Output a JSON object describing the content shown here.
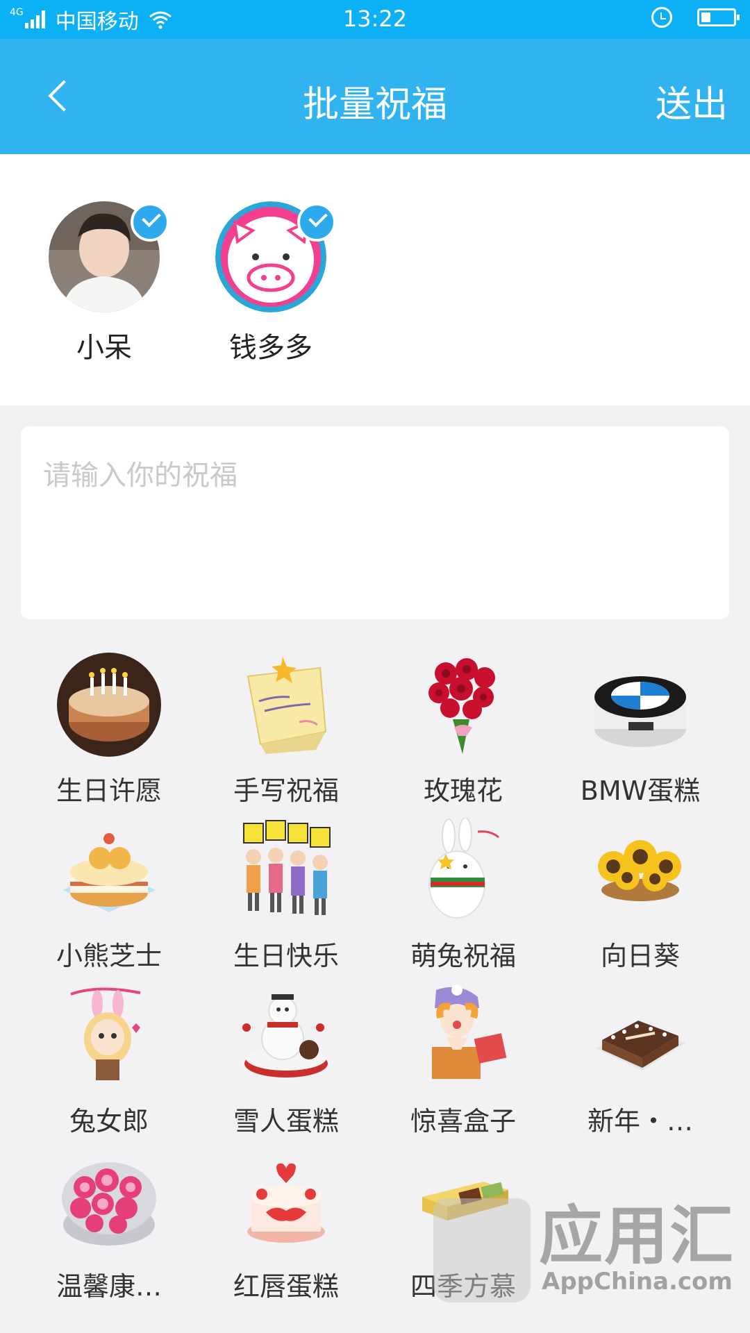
{
  "status_bar": {
    "network": "4G",
    "carrier": "中国移动",
    "time": "13:22",
    "icons": [
      "signal-icon",
      "wifi-icon",
      "alarm-icon",
      "battery-icon"
    ],
    "battery_level": 0.3
  },
  "header": {
    "title": "批量祝福",
    "send_label": "送出",
    "back_icon": "chevron-left-icon",
    "background": "#30b3ef"
  },
  "recipients": [
    {
      "name": "小呆",
      "selected": true
    },
    {
      "name": "钱多多",
      "selected": true
    }
  ],
  "message": {
    "placeholder": "请输入你的祝福"
  },
  "gifts": [
    {
      "label": "生日许愿",
      "icon": "birthday-cake-candles-icon"
    },
    {
      "label": "手写祝福",
      "icon": "sticky-note-icon"
    },
    {
      "label": "玫瑰花",
      "icon": "rose-bouquet-icon"
    },
    {
      "label": "BMW蛋糕",
      "icon": "bmw-cake-icon"
    },
    {
      "label": "小熊芝士",
      "icon": "bear-cheese-cake-icon"
    },
    {
      "label": "生日快乐",
      "icon": "birthday-kids-icon"
    },
    {
      "label": "萌兔祝福",
      "icon": "cute-rabbit-icon"
    },
    {
      "label": "向日葵",
      "icon": "sunflower-basket-icon"
    },
    {
      "label": "兔女郎",
      "icon": "bunny-girl-icon"
    },
    {
      "label": "雪人蛋糕",
      "icon": "snowman-cake-icon"
    },
    {
      "label": "惊喜盒子",
      "icon": "surprise-box-icon"
    },
    {
      "label": "新年・…",
      "icon": "new-year-cake-icon"
    },
    {
      "label": "温馨康…",
      "icon": "carnation-icon"
    },
    {
      "label": "红唇蛋糕",
      "icon": "lips-cake-icon"
    },
    {
      "label": "四季方慕",
      "icon": "square-mousse-icon"
    }
  ],
  "watermark": {
    "text": "应用汇",
    "subtext": "AppChina.com"
  }
}
